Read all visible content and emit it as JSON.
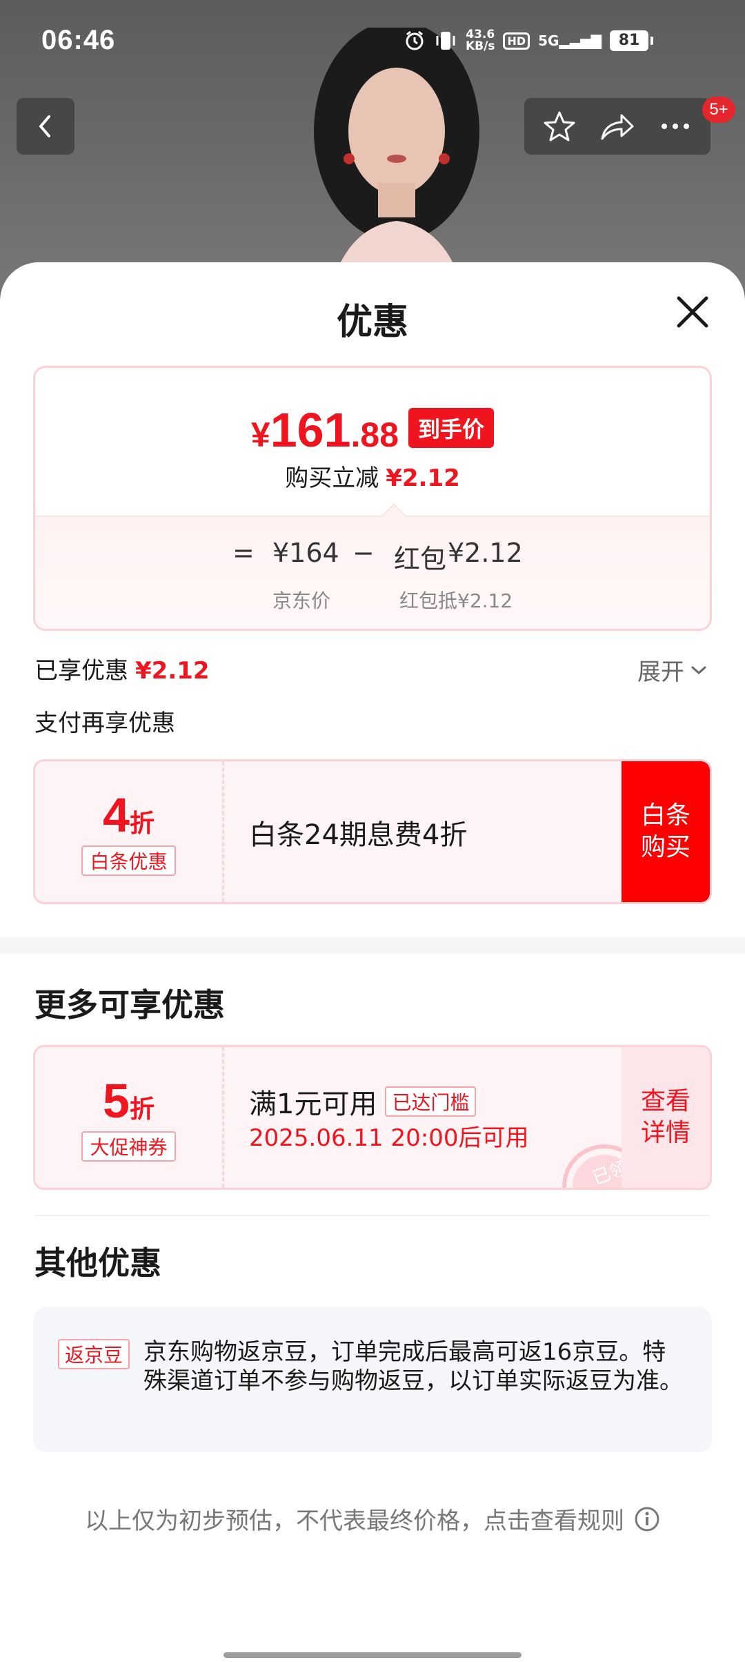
{
  "status_bar": {
    "time": "06:46",
    "net_speed_value": "43.6",
    "net_speed_unit": "KB/s",
    "hd": "HD",
    "signal": "5G",
    "battery": "81"
  },
  "nav": {
    "badge": "5+"
  },
  "sheet": {
    "title": "优惠"
  },
  "price_card": {
    "currency": "¥",
    "price_int": "161",
    "price_dec": ".88",
    "price_tag": "到手价",
    "instant_reduce_label": "购买立减",
    "instant_reduce_value": "¥2.12",
    "formula_equals": "=",
    "jd_price": "¥164",
    "minus": "−",
    "redpacket_label": "红包",
    "redpacket_value": "¥2.12",
    "jd_price_caption": "京东价",
    "redpacket_caption": "红包抵¥2.12"
  },
  "enjoyed": {
    "label": "已享优惠",
    "value": "¥2.12",
    "expand_label": "展开"
  },
  "pay_more": {
    "label": "支付再享优惠"
  },
  "baitiao_coupon": {
    "discount_num": "4",
    "discount_unit": "折",
    "tag": "白条优惠",
    "description": "白条24期息费4折",
    "action_line1": "白条",
    "action_line2": "购买"
  },
  "more_section": {
    "title": "更多可享优惠"
  },
  "promo_coupon": {
    "discount_num": "5",
    "discount_unit": "折",
    "tag": "大促神券",
    "condition": "满1元可用",
    "reached_badge": "已达门槛",
    "time_text": "2025.06.11 20:00后可用",
    "action_line1": "查看",
    "action_line2": "详情",
    "stamp_text": "已领"
  },
  "other_section": {
    "title": "其他优惠",
    "rebate_tag": "返京豆",
    "rebate_text": "京东购物返京豆，订单完成后最高可返16京豆。特殊渠道订单不参与购物返豆，以订单实际返豆为准。"
  },
  "footer": {
    "note": "以上仅为初步预估，不代表最终价格，点击查看规则"
  },
  "colors": {
    "accent_red": "#f0141e",
    "coupon_bg": "#fff4f5",
    "coupon_border": "#fcd2d8"
  }
}
